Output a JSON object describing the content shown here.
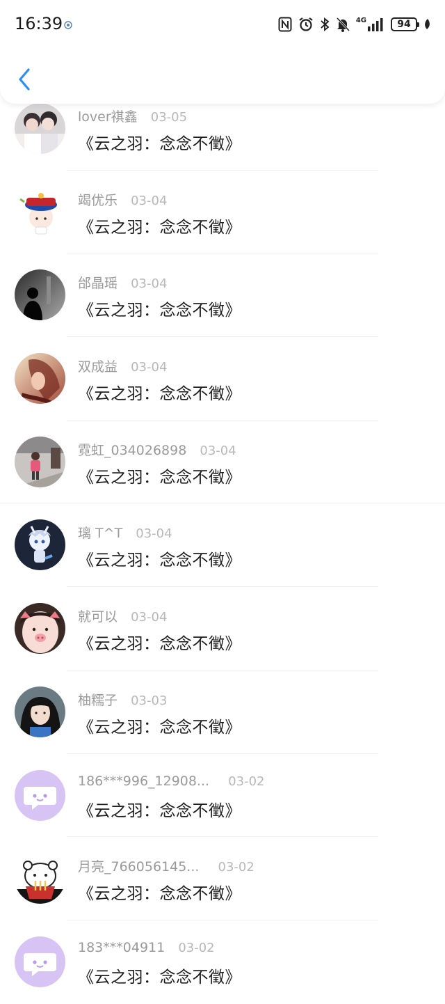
{
  "status_bar": {
    "time": "16:39",
    "network": "4G",
    "battery": "94"
  },
  "header": {
    "back_icon": "chevron-left-icon",
    "accent_color": "#2c8ef5"
  },
  "list": {
    "items": [
      {
        "name": "lover祺鑫",
        "date": "03-05",
        "title": "《云之羽：念念不徵》",
        "avatar": "photo-couple"
      },
      {
        "name": "竭优乐",
        "date": "03-04",
        "title": "《云之羽：念念不徵》",
        "avatar": "cartoon-hat"
      },
      {
        "name": "邰晶瑶",
        "date": "03-04",
        "title": "《云之羽：念念不徵》",
        "avatar": "silhouette"
      },
      {
        "name": "双成益",
        "date": "03-04",
        "title": "《云之羽：念念不徵》",
        "avatar": "photo-girl-warm"
      },
      {
        "name": "霓虹_034026898",
        "date": "03-04",
        "title": "《云之羽：念念不徵》",
        "avatar": "photo-child"
      },
      {
        "name": "璃 T^T",
        "date": "03-04",
        "title": "《云之羽：念念不徵》",
        "avatar": "anime-boy"
      },
      {
        "name": "就可以",
        "date": "03-04",
        "title": "《云之羽：念念不徵》",
        "avatar": "pig-filter-face"
      },
      {
        "name": "柚糯子",
        "date": "03-03",
        "title": "《云之羽：念念不徵》",
        "avatar": "photo-girl"
      },
      {
        "name": "186***996_12908...",
        "date": "03-02",
        "title": "《云之羽：念念不徵》",
        "avatar": "default-chat-bubble"
      },
      {
        "name": "月亮_766056145...",
        "date": "03-02",
        "title": "《云之羽：念念不徵》",
        "avatar": "cartoon-bear-noodles"
      },
      {
        "name": "183***04911",
        "date": "03-02",
        "title": "《云之羽：念念不徵》",
        "avatar": "default-chat-bubble"
      }
    ]
  }
}
